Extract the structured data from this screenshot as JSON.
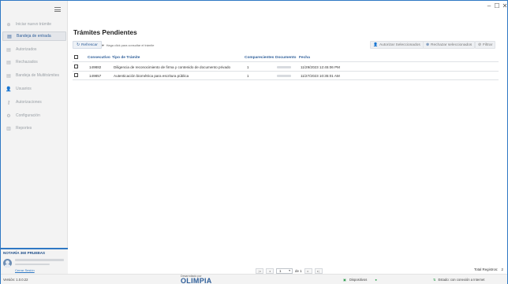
{
  "window": {
    "controls": {
      "minimize": "–",
      "maximize": "☐",
      "close": "✕"
    }
  },
  "sidebar": {
    "items": [
      {
        "label": "Iniciar nuevo trámite",
        "icon": "plus-circle-icon",
        "glyph": "⊕",
        "active": false
      },
      {
        "label": "Bandeja de entrada",
        "icon": "document-icon",
        "glyph": "▤",
        "active": true
      },
      {
        "label": "Autorizados",
        "icon": "document-check-icon",
        "glyph": "▤",
        "active": false
      },
      {
        "label": "Rechazados",
        "icon": "document-x-icon",
        "glyph": "▤",
        "active": false
      },
      {
        "label": "Bandeja de Multitrámites",
        "icon": "document-stack-icon",
        "glyph": "▤",
        "active": false
      },
      {
        "label": "Usuarios",
        "icon": "user-icon",
        "glyph": "👤",
        "active": false
      },
      {
        "label": "Autorizaciones",
        "icon": "key-icon",
        "glyph": "⚷",
        "active": false
      },
      {
        "label": "Configuración",
        "icon": "gear-icon",
        "glyph": "⚙",
        "active": false
      },
      {
        "label": "Reportes",
        "icon": "chart-icon",
        "glyph": "▥",
        "active": false
      }
    ],
    "org": {
      "name": "NOTARÍA 360 PRUEBAS",
      "logout": "Cerrar Sesión"
    }
  },
  "main": {
    "title": "Trámites Pendientes",
    "toolbar": {
      "refresh": "Refrescar",
      "hint": "Haga click para consultar el trámite",
      "authorize": "Autorizar Seleccionados",
      "reject": "Rechazar seleccionados",
      "filter": "Filtrar"
    },
    "table": {
      "headers": {
        "consecutivo": "Consecutivo",
        "tipo": "Tipo de Trámite",
        "comparecientes": "Comparecientes",
        "documento": "Documento",
        "fecha": "Fecha"
      },
      "rows": [
        {
          "consecutivo": "149882",
          "tipo": "Diligencia de reconocimiento de firma y contenido de documento privado",
          "comparecientes": "1",
          "fecha": "11/29/2023 12:45:06 PM"
        },
        {
          "consecutivo": "149857",
          "tipo": "Autenticación biométrica para escritura pública",
          "comparecientes": "1",
          "fecha": "11/27/2023 10:35:01 AM"
        }
      ]
    },
    "pager": {
      "page": "1",
      "of_label": "de 1",
      "total_label": "Total Registros:",
      "total": "2"
    }
  },
  "footer": {
    "version": "Versión: 1.0.0.22",
    "brand_small": "Desarrollado por",
    "brand": "OLIMPIA",
    "devices": "Dispositivos",
    "connection": "Estado: con conexión a Internet"
  },
  "colors": {
    "accent": "#2f78c4",
    "nav_active": "#2f5f9a",
    "status_ok": "#2e9e4f"
  }
}
